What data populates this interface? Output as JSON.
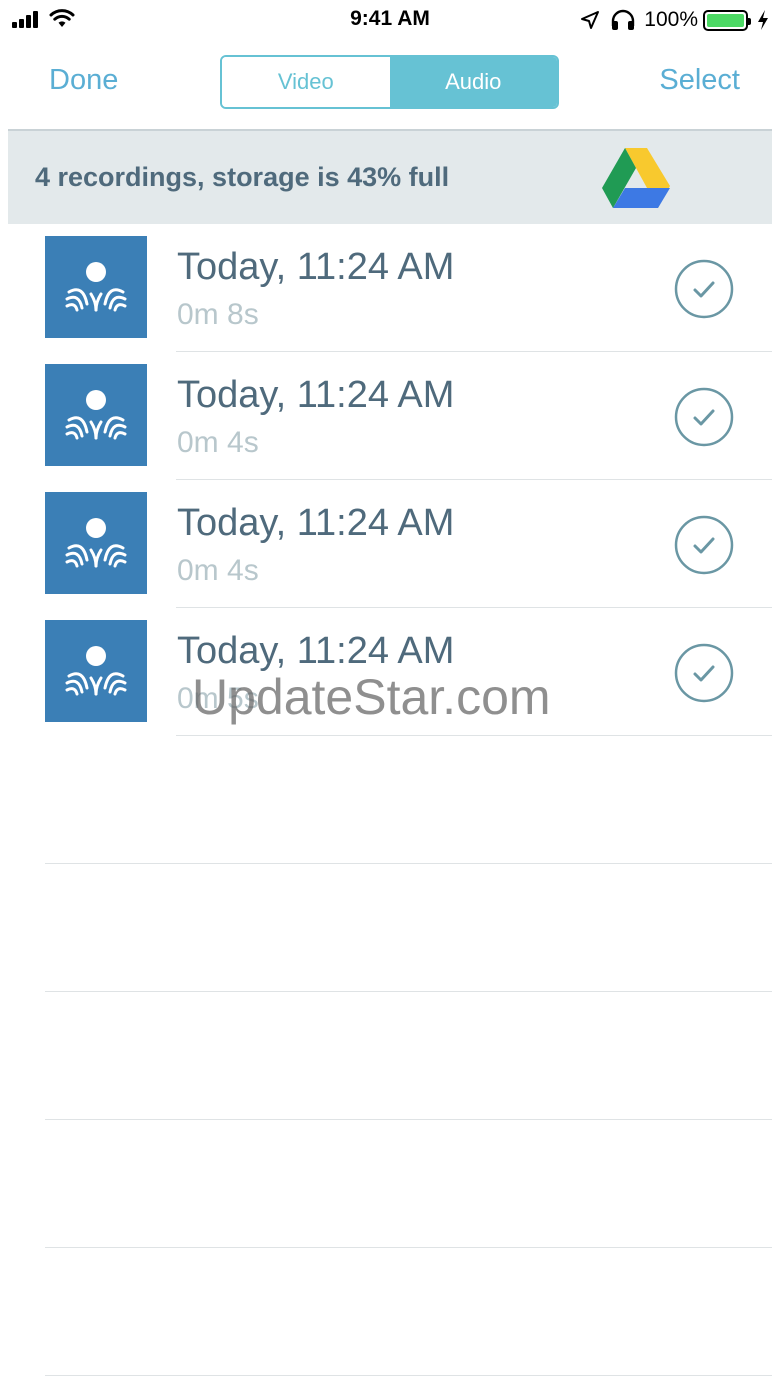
{
  "status_bar": {
    "time": "9:41 AM",
    "battery_percent": "100%",
    "battery_level": 1.0,
    "icons": [
      "signal-icon",
      "wifi-icon",
      "location-arrow-icon",
      "headphones-icon",
      "battery-icon",
      "charging-bolt-icon"
    ]
  },
  "nav": {
    "done_label": "Done",
    "select_label": "Select",
    "segments": [
      {
        "label": "Video",
        "selected": false
      },
      {
        "label": "Audio",
        "selected": true
      }
    ]
  },
  "banner": {
    "text": "4 recordings, storage is 43% full",
    "storage_percent": 43,
    "icon": "google-drive-icon"
  },
  "recordings": [
    {
      "title": "Today, 11:24 AM",
      "duration": "0m 8s",
      "selected": true
    },
    {
      "title": "Today, 11:24 AM",
      "duration": "0m 4s",
      "selected": true
    },
    {
      "title": "Today, 11:24 AM",
      "duration": "0m 4s",
      "selected": true
    },
    {
      "title": "Today, 11:24 AM",
      "duration": "0m 5s",
      "selected": true
    }
  ],
  "watermark": "UpdateStar.com",
  "colors": {
    "accent": "#5aaed4",
    "segment": "#66c2d4",
    "banner_bg": "#e3e9eb",
    "title_text": "#4f6a7c",
    "thumb_bg": "#3b7fb6",
    "duration_text": "#b8c7cc"
  }
}
